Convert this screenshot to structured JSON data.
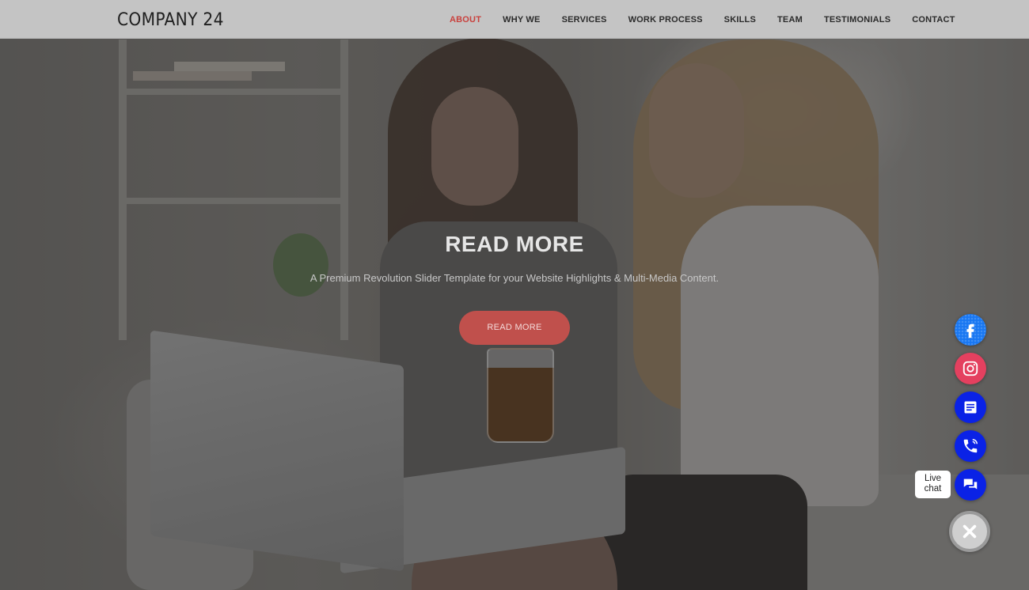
{
  "brand": {
    "logo": "COMPANY 24"
  },
  "nav": {
    "items": [
      {
        "label": "ABOUT",
        "active": true
      },
      {
        "label": "WHY WE",
        "active": false
      },
      {
        "label": "SERVICES",
        "active": false
      },
      {
        "label": "WORK PROCESS",
        "active": false
      },
      {
        "label": "SKILLS",
        "active": false
      },
      {
        "label": "TEAM",
        "active": false
      },
      {
        "label": "TESTIMONIALS",
        "active": false
      },
      {
        "label": "CONTACT",
        "active": false
      }
    ]
  },
  "hero": {
    "title": "READ MORE",
    "subtitle": "A Premium Revolution Slider Template for your Website Highlights & Multi-Media Content.",
    "cta_label": "READ MORE"
  },
  "floating_buttons": {
    "items": [
      {
        "icon": "facebook-icon"
      },
      {
        "icon": "instagram-icon"
      },
      {
        "icon": "form-icon"
      },
      {
        "icon": "phone-icon"
      },
      {
        "icon": "chat-icon"
      }
    ],
    "live_chat_line1": "Live",
    "live_chat_line2": "chat",
    "close_icon": "close-icon"
  },
  "colors": {
    "accent": "#c9413d",
    "cta_bg": "#c0504c",
    "facebook": "#1877f2",
    "instagram": "#e4405f",
    "contact_blue": "#0a22e6",
    "header_bg": "#c4c4c4"
  }
}
